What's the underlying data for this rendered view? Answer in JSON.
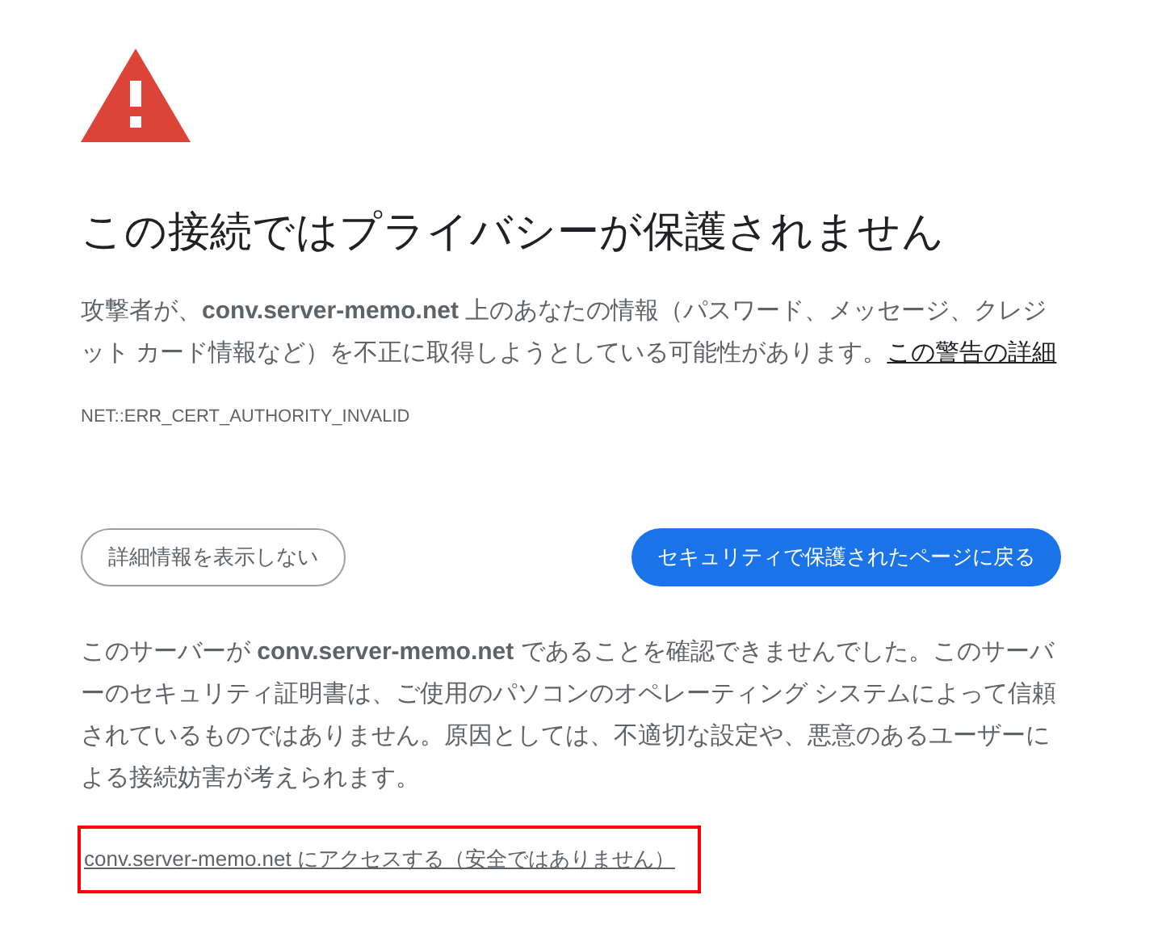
{
  "heading": "この接続ではプライバシーが保護されません",
  "warning": {
    "text": "攻撃者が、**conv.server-memo.net** 上のあなたの情報（パスワード、メッセージ、クレジット カード情報など）を不正に取得しようとしている可能性があります。",
    "link": "この警告の詳細"
  },
  "error_code": "NET::ERR_CERT_AUTHORITY_INVALID",
  "buttons": [
    {
      "label": "詳細情報を表示しない",
      "kind": "outline"
    },
    {
      "label": "セキュリティで保護されたページに戻る",
      "kind": "primary"
    }
  ],
  "details": "このサーバーが **conv.server-memo.net** であることを確認できませんでした。このサーバーのセキュリティ証明書は、ご使用のパソコンのオペレーティング システムによって信頼されているものではありません。原因としては、不適切な設定や、悪意のあるユーザーによる接続妨害が考えられます。",
  "proceed_link": "conv.server-memo.net にアクセスする（安全ではありません）"
}
